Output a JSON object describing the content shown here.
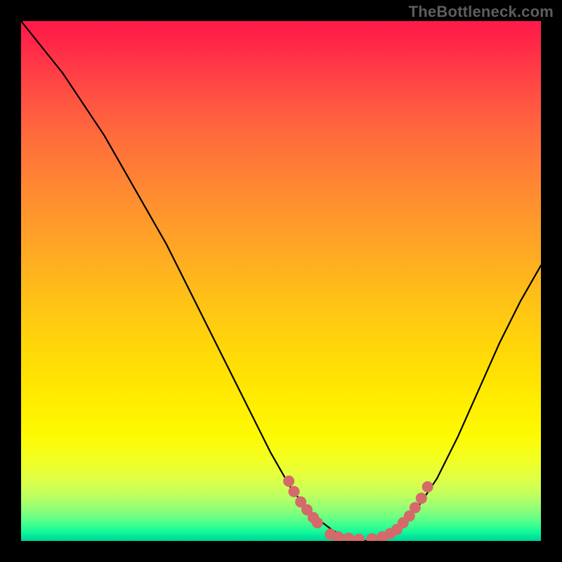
{
  "attribution": "TheBottleneck.com",
  "chart_data": {
    "type": "line",
    "title": "",
    "xlabel": "",
    "ylabel": "",
    "xlim": [
      0,
      100
    ],
    "ylim": [
      0,
      100
    ],
    "background_gradient": {
      "direction": "vertical",
      "stops": [
        {
          "pos": 0,
          "color": "#ff1a49"
        },
        {
          "pos": 50,
          "color": "#ffc216"
        },
        {
          "pos": 80,
          "color": "#fdfa04"
        },
        {
          "pos": 100,
          "color": "#00d596"
        }
      ]
    },
    "series": [
      {
        "name": "bottleneck-curve",
        "x": [
          0,
          4,
          8,
          12,
          16,
          20,
          24,
          28,
          32,
          36,
          40,
          44,
          48,
          52,
          56,
          60,
          64,
          68,
          72,
          76,
          80,
          84,
          88,
          92,
          96,
          100
        ],
        "y": [
          100,
          95,
          90,
          84,
          78,
          71,
          64,
          57,
          49,
          41,
          33,
          25,
          17,
          10,
          5,
          2,
          0,
          0,
          2,
          6,
          12,
          20,
          29,
          38,
          46,
          53
        ],
        "color": "#000000"
      }
    ],
    "highlight_points": {
      "name": "threshold-dots",
      "color": "#d46a6a",
      "points": [
        {
          "x": 51.5,
          "y": 11.5
        },
        {
          "x": 52.5,
          "y": 9.5
        },
        {
          "x": 53.8,
          "y": 7.5
        },
        {
          "x": 55.0,
          "y": 6.0
        },
        {
          "x": 56.2,
          "y": 4.5
        },
        {
          "x": 57.0,
          "y": 3.5
        },
        {
          "x": 59.5,
          "y": 1.3
        },
        {
          "x": 61.0,
          "y": 0.8
        },
        {
          "x": 63.0,
          "y": 0.5
        },
        {
          "x": 65.0,
          "y": 0.3
        },
        {
          "x": 67.5,
          "y": 0.4
        },
        {
          "x": 69.5,
          "y": 0.8
        },
        {
          "x": 71.0,
          "y": 1.4
        },
        {
          "x": 72.3,
          "y": 2.2
        },
        {
          "x": 73.5,
          "y": 3.5
        },
        {
          "x": 74.7,
          "y": 4.8
        },
        {
          "x": 75.8,
          "y": 6.4
        },
        {
          "x": 77.0,
          "y": 8.2
        },
        {
          "x": 78.2,
          "y": 10.4
        }
      ]
    }
  }
}
